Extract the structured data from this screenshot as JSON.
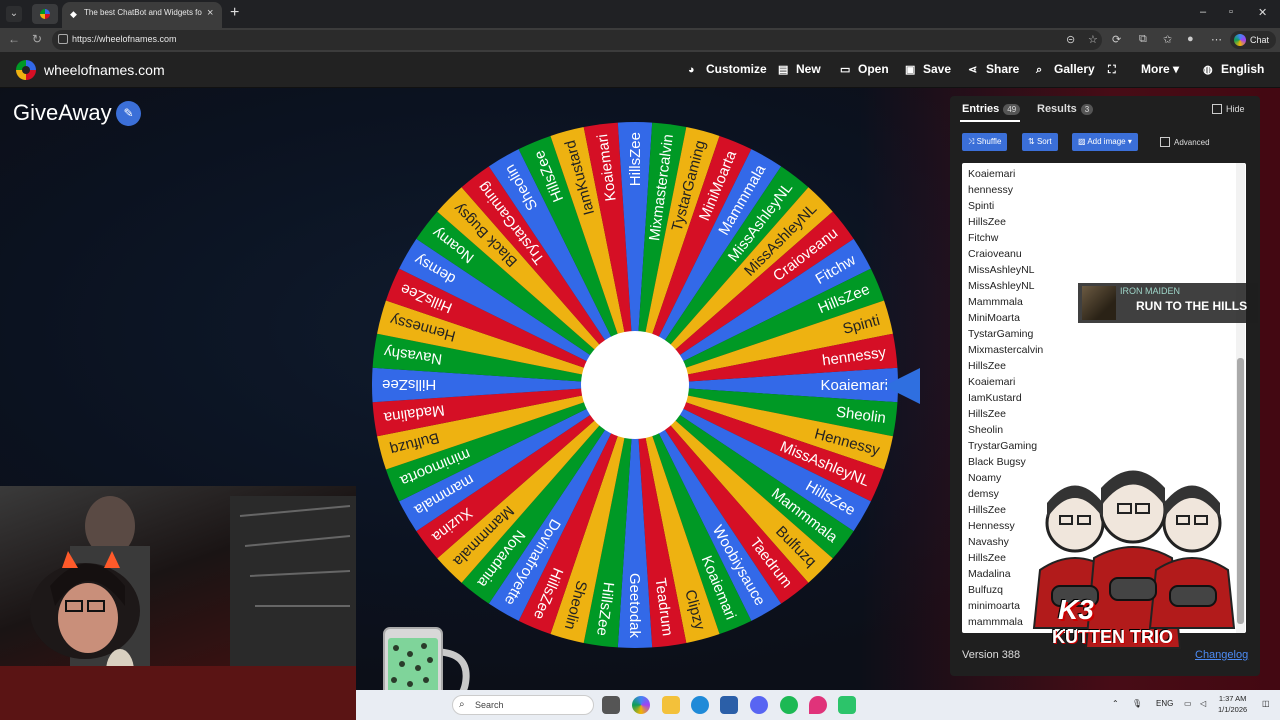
{
  "browser": {
    "tab_title": "The best ChatBot and Widgets for",
    "url": "https://wheelofnames.com",
    "chat_label": "Chat"
  },
  "site": {
    "brand": "wheelofnames.com",
    "menu": [
      {
        "label": "Customize",
        "icon": "palette-icon"
      },
      {
        "label": "New",
        "icon": "new-file-icon"
      },
      {
        "label": "Open",
        "icon": "folder-icon"
      },
      {
        "label": "Save",
        "icon": "save-icon"
      },
      {
        "label": "Share",
        "icon": "share-icon"
      },
      {
        "label": "Gallery",
        "icon": "search-icon"
      },
      {
        "label": "",
        "icon": "fullscreen-icon"
      },
      {
        "label": "More",
        "icon": "chevron-down-icon"
      },
      {
        "label": "English",
        "icon": "globe-icon"
      }
    ]
  },
  "wheel": {
    "title": "GiveAway",
    "colors": [
      "#3369e8",
      "#009925",
      "#eeb211",
      "#d50f25"
    ],
    "names": [
      "Koaiemari",
      "Sheolin",
      "Hennessy",
      "MissAshleyNL",
      "HillsZee",
      "Mammmala",
      "Bulfuzq",
      "Taedrum",
      "Woobiysauce",
      "Koaiemari",
      "Clipzy",
      "Teadrum",
      "Geetodak",
      "HillsZee",
      "Sheolin",
      "HillsZee",
      "Dovinafroyette",
      "Novadmia",
      "Mammmala",
      "Xuzina",
      "mammala",
      "minimoorta",
      "Bulfuzq",
      "Madalina",
      "HillsZee",
      "Navashy",
      "Hennessy",
      "HillsZee",
      "demsy",
      "Noamy",
      "Black Bugsy",
      "TrystarGaming",
      "Sheolin",
      "HillsZee",
      "IamKustard",
      "Koaiemari",
      "HillsZee",
      "Mixmastercalvin",
      "TystarGaming",
      "MiniMoarta",
      "Mammmala",
      "MissAshleyNL",
      "MissAshleyNL",
      "Craioveanu",
      "Fitchw",
      "HillsZee",
      "Spinti",
      "hennessy"
    ]
  },
  "panel": {
    "tab_entries": "Entries",
    "entries_count": "49",
    "tab_results": "Results",
    "results_count": "3",
    "hide_label": "Hide",
    "shuffle_label": "Shuffle",
    "sort_label": "Sort",
    "add_image_label": "Add image",
    "advanced_label": "Advanced",
    "entries": [
      "Koaiemari",
      "hennessy",
      "Spinti",
      "HillsZee",
      "Fitchw",
      "Craioveanu",
      "MissAshleyNL",
      "MissAshleyNL",
      "Mammmala",
      "MiniMoarta",
      "TystarGaming",
      "Mixmastercalvin",
      "HillsZee",
      "Koaiemari",
      "IamKustard",
      "HillsZee",
      "Sheolin",
      "TrystarGaming",
      "Black Bugsy",
      "Noamy",
      "demsy",
      "HillsZee",
      "Hennessy",
      "Navashy",
      "HillsZee",
      "Madalina",
      "Bulfuzq",
      "minimoarta",
      "mammmala"
    ],
    "version": "Version 388",
    "changelog": "Changelog"
  },
  "now_playing": {
    "artist": "IRON MAIDEN",
    "song": "RUN TO THE HILLS"
  },
  "overlay": {
    "k3_title": "K3",
    "k3_sub": "KUTTEN TRIO"
  },
  "taskbar": {
    "search_placeholder": "Search",
    "lang": "ENG",
    "time": "1:37 AM",
    "date": "1/1/2026"
  }
}
